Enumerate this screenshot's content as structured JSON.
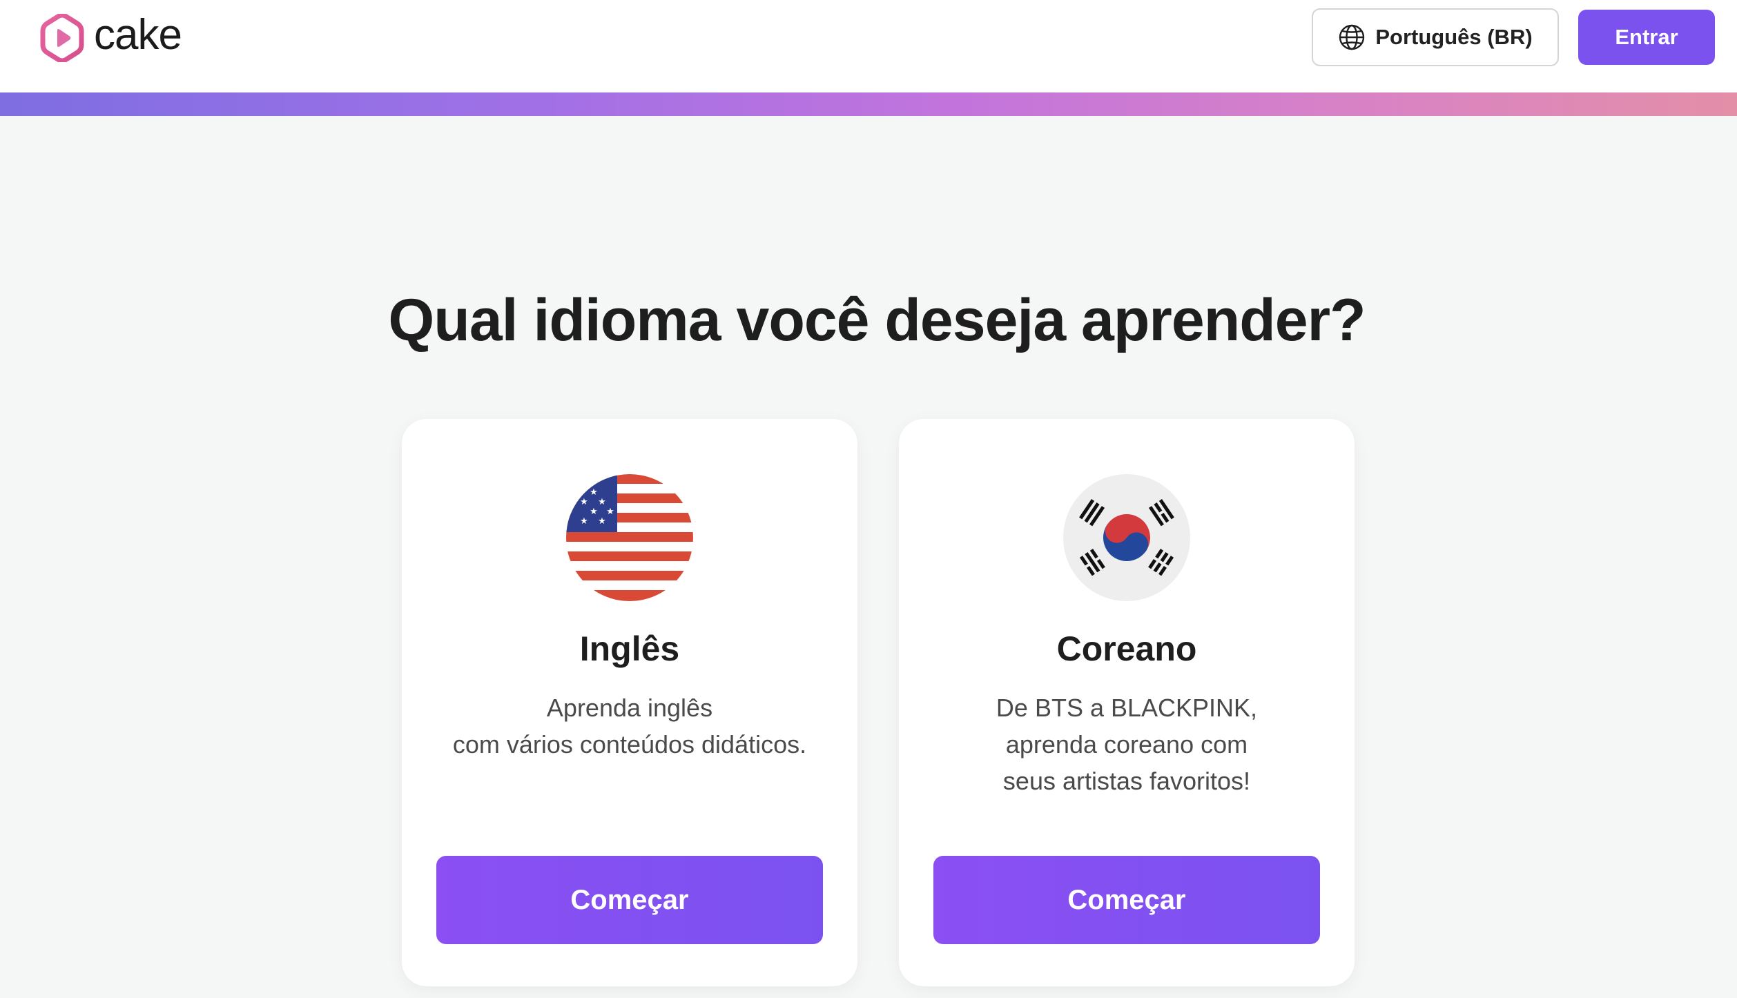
{
  "header": {
    "logo_text": "cake",
    "language_button": "Português (BR)",
    "login_button": "Entrar"
  },
  "main": {
    "title": "Qual idioma você deseja aprender?",
    "courses": [
      {
        "name": "Inglês",
        "flag_icon": "us-flag-icon",
        "description_lines": [
          "Aprenda inglês",
          "com vários conteúdos didáticos."
        ],
        "button_label": "Começar"
      },
      {
        "name": "Coreano",
        "flag_icon": "korea-flag-icon",
        "description_lines": [
          "De BTS a BLACKPINK,",
          "aprenda coreano com",
          "seus artistas favoritos!"
        ],
        "button_label": "Começar"
      }
    ]
  },
  "colors": {
    "accent": "#7c52ef",
    "logo_pink": "#e06aa6",
    "background": "#f5f6f6"
  }
}
